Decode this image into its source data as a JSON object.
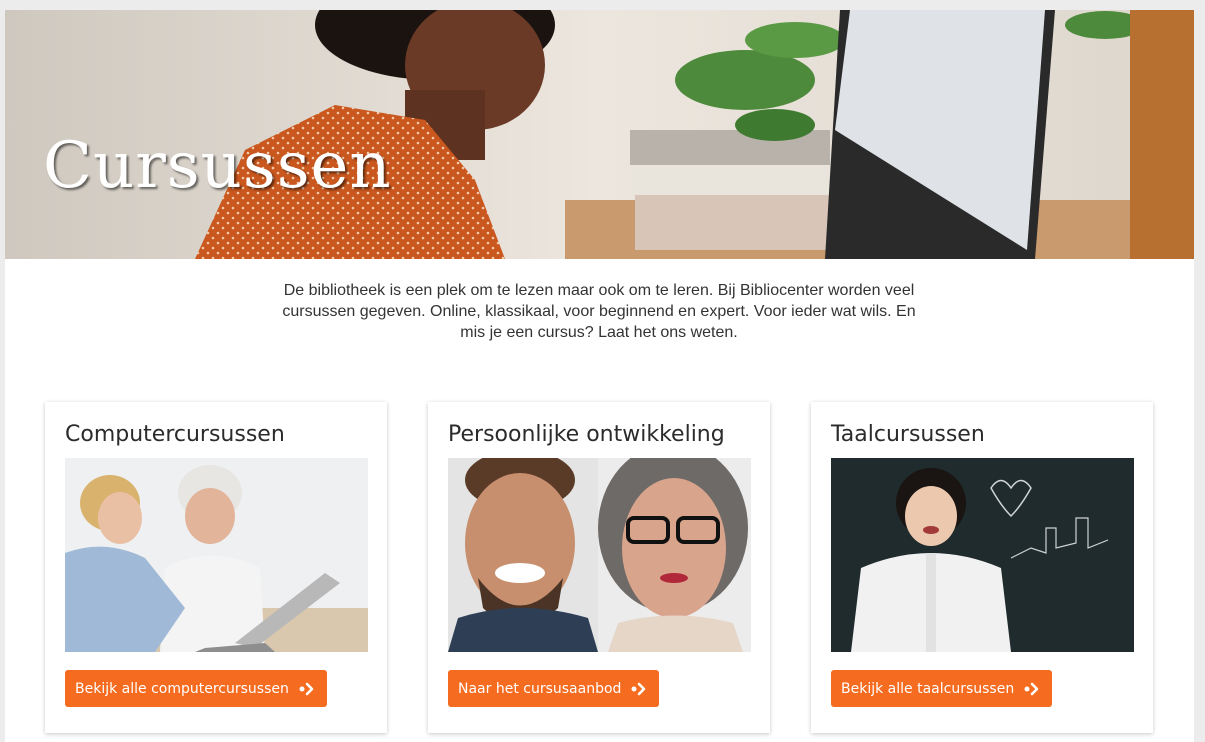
{
  "hero": {
    "title": "Cursussen"
  },
  "intro": {
    "text": "De bibliotheek is een plek om te lezen maar ook om te leren. Bij Bibliocenter worden veel cursussen gegeven. Online, klassikaal, voor beginnend en expert. Voor ieder wat wils. En mis je een cursus? Laat het ons weten."
  },
  "cards": [
    {
      "title": "Computercursussen",
      "button_label": "Bekijk alle computercursussen",
      "image": "photo-two-women-laptop"
    },
    {
      "title": "Persoonlijke ontwikkeling",
      "button_label": "Naar het cursusaanbod",
      "image": "photo-smiling-man-and-woman"
    },
    {
      "title": "Taalcursussen",
      "button_label": "Bekijk alle taalcursussen",
      "image": "photo-girl-chalkboard"
    }
  ],
  "colors": {
    "accent": "#f56b1f",
    "text": "#333333",
    "heading": "#2b2b2b"
  },
  "icons": {
    "button_arrow": "double-chevron-right-icon"
  }
}
